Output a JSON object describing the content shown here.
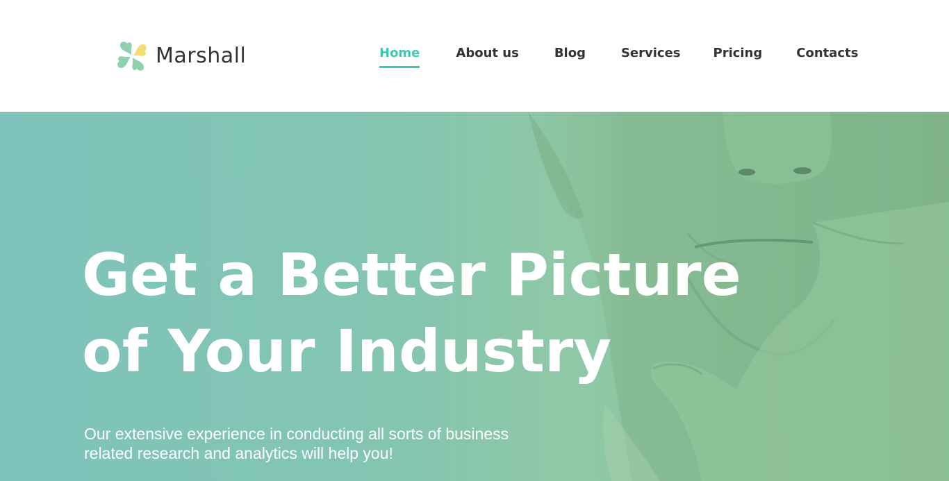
{
  "header": {
    "logo": {
      "icon": "clover-icon",
      "text": "Marshall"
    },
    "nav": [
      {
        "label": "Home",
        "active": true
      },
      {
        "label": "About us",
        "active": false
      },
      {
        "label": "Blog",
        "active": false
      },
      {
        "label": "Services",
        "active": false
      },
      {
        "label": "Pricing",
        "active": false
      },
      {
        "label": "Contacts",
        "active": false
      }
    ]
  },
  "hero": {
    "title_line1": "Get a Better Picture",
    "title_line2": "of Your Industry",
    "subtitle_line1": "Our extensive experience in conducting all sorts of business",
    "subtitle_line2": "related research and analytics will help you!"
  },
  "colors": {
    "accent": "#3cc9b4",
    "text_dark": "#333333",
    "logo_yellow": "#f3dd73",
    "logo_green": "#8fd1ae",
    "hero_tint": "#8cc6a6"
  }
}
